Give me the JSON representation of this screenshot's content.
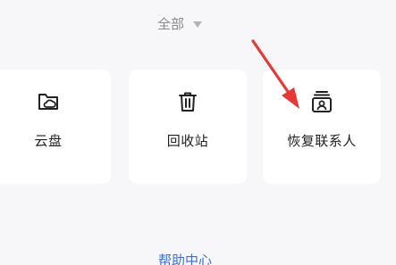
{
  "filter": {
    "label": "全部",
    "icon": "caret-down-icon"
  },
  "cards": [
    {
      "label": "云盘",
      "icon": "cloud-folder-icon"
    },
    {
      "label": "回收站",
      "icon": "trash-icon"
    },
    {
      "label": "恢复联系人",
      "icon": "contact-restore-icon"
    }
  ],
  "help": {
    "label": "帮助中心"
  },
  "annotation": {
    "icon": "red-arrow-icon",
    "color": "#e53935"
  }
}
